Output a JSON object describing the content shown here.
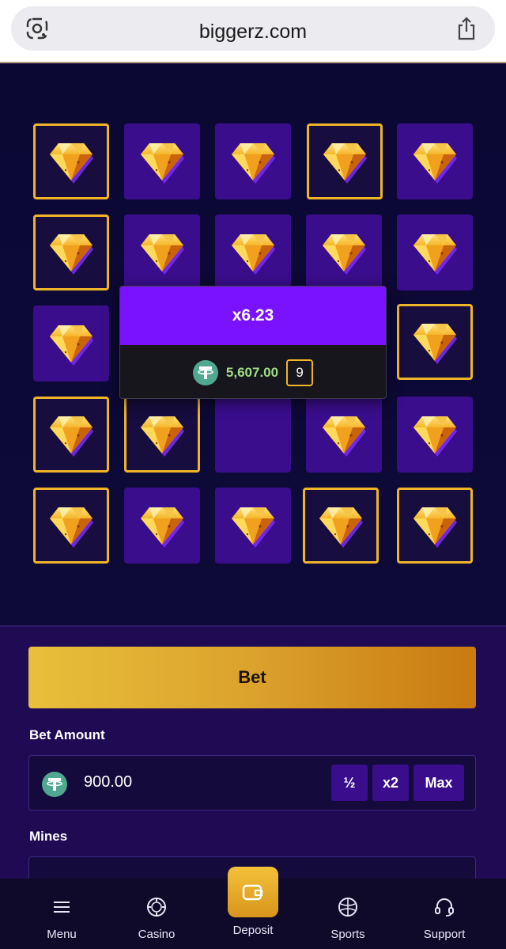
{
  "browser": {
    "url": "biggerz.com",
    "lens_icon": "google-lens-icon",
    "share_icon": "share-icon"
  },
  "board": {
    "rows": [
      [
        "selected-gem",
        "gem",
        "gem",
        "selected-gem",
        "gem"
      ],
      [
        "selected-gem",
        "gem",
        "gem",
        "gem",
        "gem"
      ],
      [
        "gem",
        "hidden",
        "hidden",
        "hidden",
        "selected-gem"
      ],
      [
        "selected-gem",
        "selected-gem",
        "empty",
        "gem",
        "gem"
      ],
      [
        "selected-gem",
        "gem",
        "gem",
        "selected-gem",
        "selected-gem"
      ]
    ]
  },
  "popup": {
    "multiplier": "x6.23",
    "amount": "5,607.00",
    "mines_count": "9",
    "currency_icon": "tether-icon"
  },
  "controls": {
    "bet_label": "Bet",
    "bet_amount_label": "Bet Amount",
    "bet_amount_value": "900.00",
    "half_label": "½",
    "double_label": "x2",
    "max_label": "Max",
    "mines_label": "Mines"
  },
  "nav": {
    "menu": "Menu",
    "casino": "Casino",
    "deposit": "Deposit",
    "sports": "Sports",
    "support": "Support"
  },
  "colors": {
    "tile": "#3a0d8c",
    "selected_border": "#f0b429",
    "popup_header": "#7a12ff",
    "win_amount": "#9fdf85"
  }
}
